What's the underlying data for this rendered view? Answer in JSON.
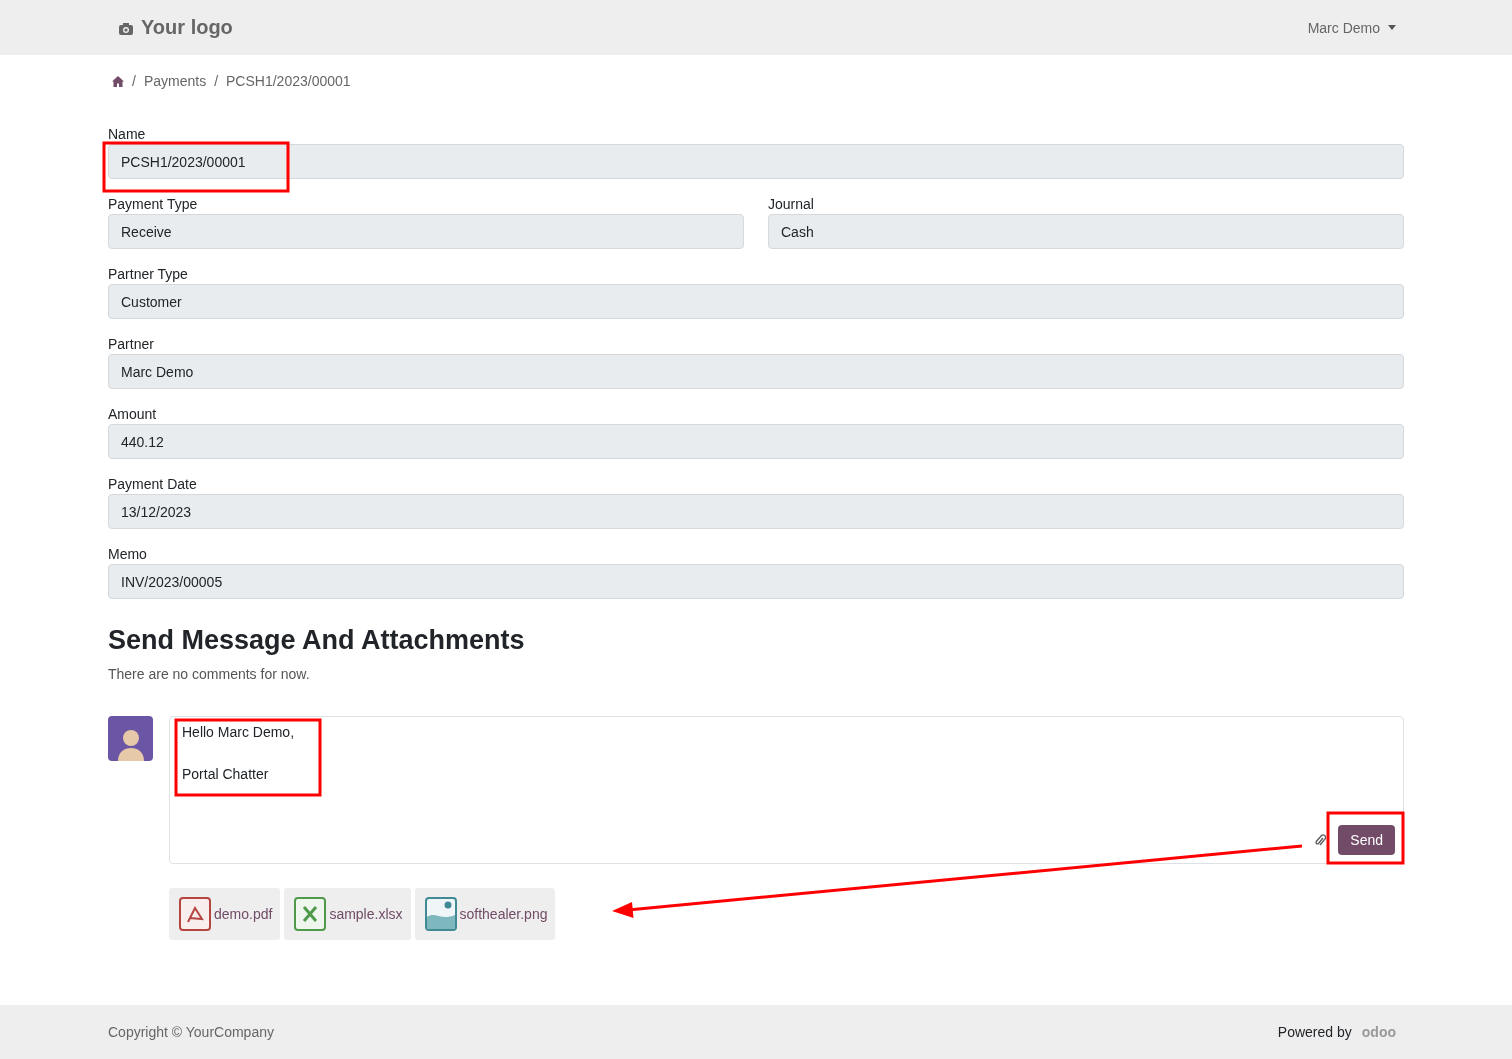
{
  "header": {
    "logo": "Your logo",
    "user": "Marc Demo"
  },
  "breadcrumb": [
    {
      "separator": "/",
      "label": "Payments"
    },
    {
      "separator": "/",
      "label": "PCSH1/2023/00001"
    }
  ],
  "form_rows": [
    [
      {
        "label": "Name",
        "value": "PCSH1/2023/00001"
      }
    ],
    [
      {
        "label": "Payment Type",
        "value": "Receive"
      },
      {
        "label": "Journal",
        "value": "Cash"
      }
    ],
    [
      {
        "label": "Partner Type",
        "value": "Customer"
      }
    ],
    [
      {
        "label": "Partner",
        "value": "Marc Demo"
      }
    ],
    [
      {
        "label": "Amount",
        "value": "440.12"
      }
    ],
    [
      {
        "label": "Payment Date",
        "value": "13/12/2023"
      }
    ],
    [
      {
        "label": "Memo",
        "value": "INV/2023/00005"
      }
    ]
  ],
  "chatter": {
    "title": "Send Message And Attachments",
    "empty_note": "There are no comments for now.",
    "message_lines": [
      "Hello Marc Demo,",
      "Portal Chatter"
    ],
    "send_button": "Send",
    "attachments": [
      {
        "kind": "pdf",
        "name": "demo.pdf"
      },
      {
        "kind": "xlsx",
        "name": "sample.xlsx"
      },
      {
        "kind": "png",
        "name": "softhealer.png"
      }
    ]
  },
  "footer": {
    "copyright": "Copyright © YourCompany",
    "powered_by": "Powered by",
    "brand": "odoo"
  }
}
